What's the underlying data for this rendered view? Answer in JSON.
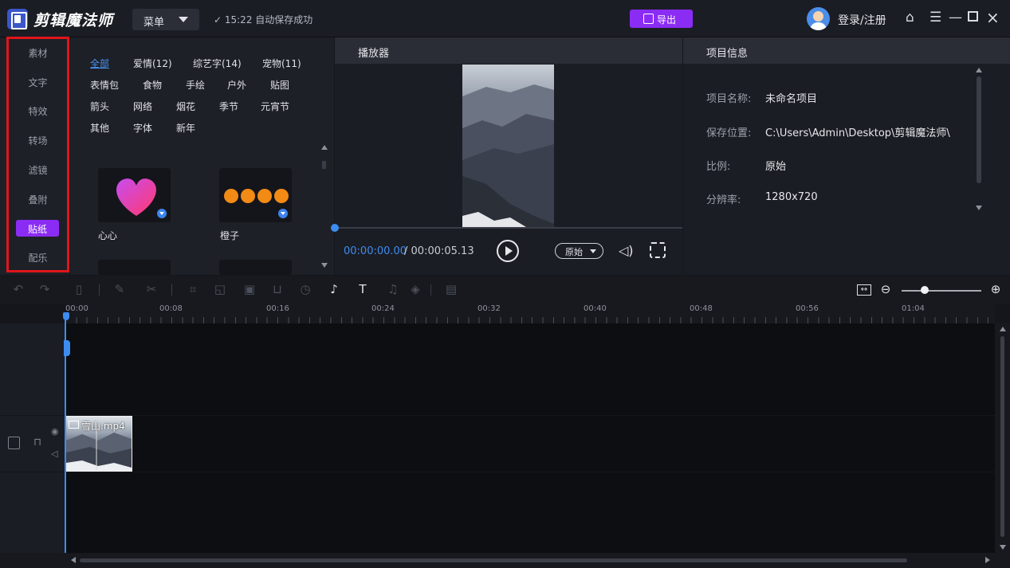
{
  "app": {
    "title": "剪辑魔法师"
  },
  "header": {
    "menu_label": "菜单",
    "save_status": "✓ 15:22 自动保存成功",
    "export_label": "导出",
    "login_label": "登录/注册"
  },
  "categories": [
    "素材",
    "文字",
    "特效",
    "转场",
    "滤镜",
    "叠附",
    "贴纸",
    "配乐"
  ],
  "active_category": "贴纸",
  "sticker_tags": {
    "row1": [
      "全部",
      "爱情(12)",
      "综艺字(14)",
      "宠物(11)"
    ],
    "row2": [
      "表情包",
      "食物",
      "手绘",
      "户外",
      "贴图"
    ],
    "row3": [
      "箭头",
      "网络",
      "烟花",
      "季节",
      "元宵节"
    ],
    "row4": [
      "其他",
      "字体",
      "新年"
    ]
  },
  "stickers": [
    {
      "name": "心心"
    },
    {
      "name": "橙子"
    }
  ],
  "player": {
    "title": "播放器",
    "current_time": "00:00:00.00",
    "separator": "/",
    "total_time": "00:00:05.13",
    "ratio": "原始"
  },
  "info": {
    "title": "项目信息",
    "name_label": "项目名称:",
    "name_value": "未命名项目",
    "path_label": "保存位置:",
    "path_value": "C:\\Users\\Admin\\Desktop\\剪辑魔法师\\",
    "ratio_label": "比例:",
    "ratio_value": "原始",
    "res_label": "分辨率:",
    "res_value": "1280x720"
  },
  "timeline": {
    "ticks": [
      "00:00",
      "00:08",
      "00:16",
      "00:24",
      "00:32",
      "00:40",
      "00:48",
      "00:56",
      "01:04"
    ],
    "clip_name": "雪山.mp4"
  },
  "colors": {
    "accent": "#8b2cf5",
    "highlight": "#e0151a",
    "blue": "#3d8cf0"
  }
}
